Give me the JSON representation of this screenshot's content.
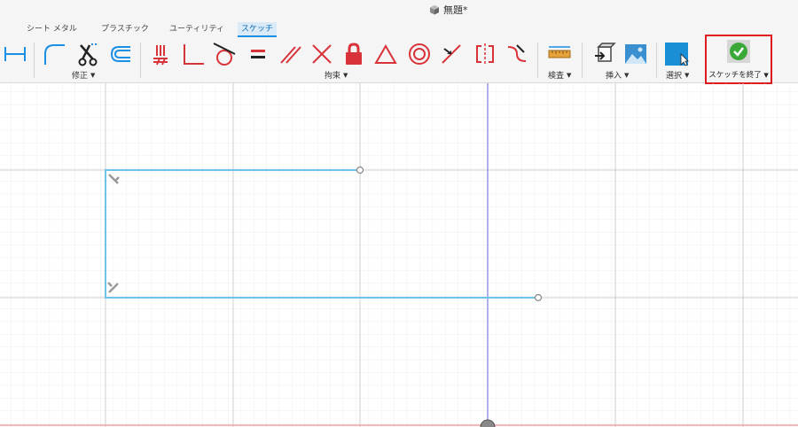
{
  "window": {
    "title": "無題*"
  },
  "tabs": [
    {
      "label": "シート メタル",
      "active": false
    },
    {
      "label": "プラスチック",
      "active": false
    },
    {
      "label": "ユーティリティ",
      "active": false
    },
    {
      "label": "スケッチ",
      "active": true
    }
  ],
  "toolbar": {
    "groups": {
      "modify": "修正",
      "constraints": "拘束",
      "inspect": "検査",
      "insert": "挿入",
      "select": "選択",
      "finish_sketch": "スケッチを終了"
    },
    "dropdown_caret": "▼"
  },
  "colors": {
    "accent": "#1a8fe3",
    "constraint_red": "#d9333a",
    "sketch_line": "#6fc3e8",
    "highlight_border": "#e0191f",
    "check_green": "#3aa836"
  }
}
